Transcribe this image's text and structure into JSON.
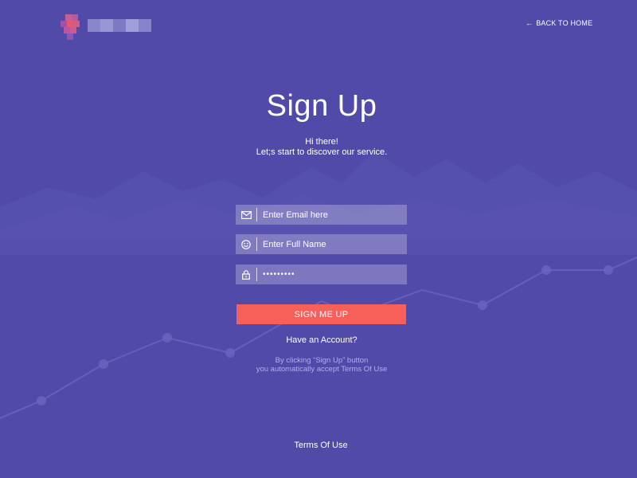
{
  "header": {
    "logo_name": "logo",
    "back_label": "BACK TO HOME",
    "back_icon": "arrow-left-icon"
  },
  "main": {
    "title": "Sign Up",
    "subtitle_line1": "Hi there!",
    "subtitle_line2": "Let;s start to discover our service."
  },
  "form": {
    "email": {
      "placeholder": "Enter Email here",
      "value": "",
      "icon": "envelope-icon"
    },
    "name": {
      "placeholder": "Enter Full Name",
      "value": "",
      "icon": "smiley-icon"
    },
    "password": {
      "placeholder": "",
      "value": "•••••••••",
      "icon": "lock-icon"
    },
    "submit_label": "SIGN ME UP"
  },
  "have_account_label": "Have an Account?",
  "terms_note_line1": "By clicking “Sign Up” button",
  "terms_note_line2": "you automatically accept Terms Of Use",
  "footer": {
    "terms_label": "Terms Of Use"
  },
  "colors": {
    "background": "#514aa8",
    "accent": "#f76059",
    "field_bg": "rgba(255,255,255,0.25)",
    "note_text": "#b2aef0"
  }
}
